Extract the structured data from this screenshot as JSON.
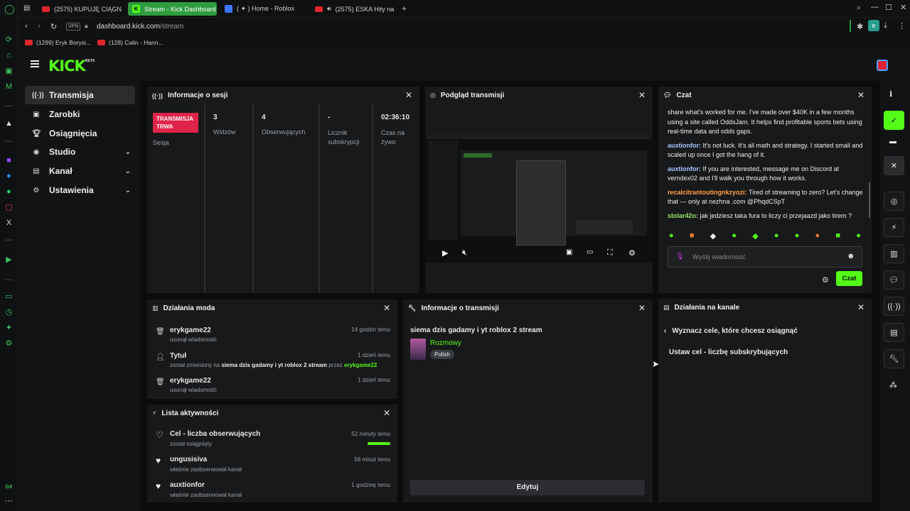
{
  "browser": {
    "tabs": [
      {
        "label": "(2575) KUPUJĘ CIĄGNIK",
        "icon": "youtube-icon"
      },
      {
        "label": "Stream - Kick Dashboard",
        "icon": "kick-icon",
        "active": true
      },
      {
        "label": "( ✦ ) Home - Roblox",
        "icon": "roblox-icon"
      },
      {
        "label": "(2575) ESKA Hity na C",
        "icon": "youtube-icon"
      }
    ],
    "url_domain": "dashboard.kick.com",
    "url_path": "/stream",
    "vpn_label": "VPN",
    "profile_letter": "e",
    "bookmarks": [
      {
        "label": "(1299) Eryk Borysi..."
      },
      {
        "label": "(128) Calin - Hann..."
      }
    ]
  },
  "app": {
    "logo": "KICK",
    "logo_badge": "BETA"
  },
  "nav": {
    "items": [
      {
        "label": "Transmisja",
        "icon": "broadcast-icon",
        "active": true
      },
      {
        "label": "Zarobki",
        "icon": "wallet-icon"
      },
      {
        "label": "Osiągnięcia",
        "icon": "trophy-icon"
      },
      {
        "label": "Studio",
        "icon": "studio-icon",
        "chevron": true
      },
      {
        "label": "Kanał",
        "icon": "channel-icon",
        "chevron": true
      },
      {
        "label": "Ustawienia",
        "icon": "gear-icon",
        "chevron": true
      }
    ]
  },
  "session": {
    "title": "Informacje o sesji",
    "live_badge": "TRANSMISJA TRWA",
    "session_label": "Sesja",
    "stats": [
      {
        "value": "3",
        "label": "Widzów"
      },
      {
        "value": "4",
        "label": "Obserwujących"
      },
      {
        "value": "-",
        "label": "Licznik subskrypcji"
      },
      {
        "value": "02:36:10",
        "label": "Czas na żywo"
      }
    ]
  },
  "preview": {
    "title": "Podgląd transmisji"
  },
  "chat": {
    "title": "Czat",
    "messages": [
      {
        "user": "",
        "text": "share what's worked for me. I've made over $40K in a few months using a site called OddsJam. It helps find profitable sports bets using real-time data and odds gaps.",
        "color": "#ffffff"
      },
      {
        "user": "auxtionfor",
        "text": "It's not luck. It's all math and strategy. I started small and scaled up once I got the hang of it.",
        "color": "#a9c5ff"
      },
      {
        "user": "auxtionfor",
        "text": "If you are interested, message me on Discord at verndex02 and I'll walk you through how it works.",
        "color": "#a9c5ff"
      },
      {
        "user": "recalcitrantoutingnkzyozi",
        "text": "Tired of streaming to zero? Let's change that — only at nezhna .com @PhqdCSpT",
        "color": "#ffa24a"
      },
      {
        "user": "stolar42o",
        "text": "jak jedziesz taka fura to liczy ci przejaazd jako tirem ?",
        "color": "#9be36a"
      }
    ],
    "placeholder": "Wyślij wiadomość",
    "send_label": "Czat"
  },
  "mod_actions": {
    "title": "Działania moda",
    "items": [
      {
        "title": "erykgame22",
        "time": "14 godzin temu",
        "sub_pre": "usunął wiadomość",
        "sub_bold": "",
        "sub_mid": "",
        "sub_user": ""
      },
      {
        "title": "Tytuł",
        "time": "1 dzień temu",
        "sub_pre": "został zmieniony na ",
        "sub_bold": "siema dzis gadamy i yt roblox 2 stream",
        "sub_mid": " przez ",
        "sub_user": "erykgame22"
      },
      {
        "title": "erykgame22",
        "time": "1 dzień temu",
        "sub_pre": "usunął wiadomość",
        "sub_bold": "",
        "sub_mid": "",
        "sub_user": ""
      }
    ]
  },
  "stream_info": {
    "title": "Informacje o transmisji",
    "stream_title": "siema dzis gadamy i yt roblox 2 stream",
    "category": "Rozmowy",
    "language_tag": "Polish",
    "edit_label": "Edytuj"
  },
  "channel_actions": {
    "title": "Działania na kanale",
    "back_title": "Wyznacz cele, które chcesz osiągnąć",
    "option": "Ustaw cel - liczbę subskrybujących"
  },
  "activity": {
    "title": "Lista aktywności",
    "items": [
      {
        "title": "Cel - liczba obserwujących",
        "sub": "został osiągnięty",
        "time": "52 minuty temu",
        "progress": 1.0
      },
      {
        "title": "ungusisiva",
        "sub": "właśnie zaobserwował kanał",
        "time": "58 minut temu"
      },
      {
        "title": "auxtionfor",
        "sub": "właśnie zaobserwował kanał",
        "time": "1 godzinę temu"
      }
    ]
  },
  "colors": {
    "brand": "#53fc18",
    "live_badge": "#e0244a",
    "tab_active": "#2e9c3f"
  }
}
